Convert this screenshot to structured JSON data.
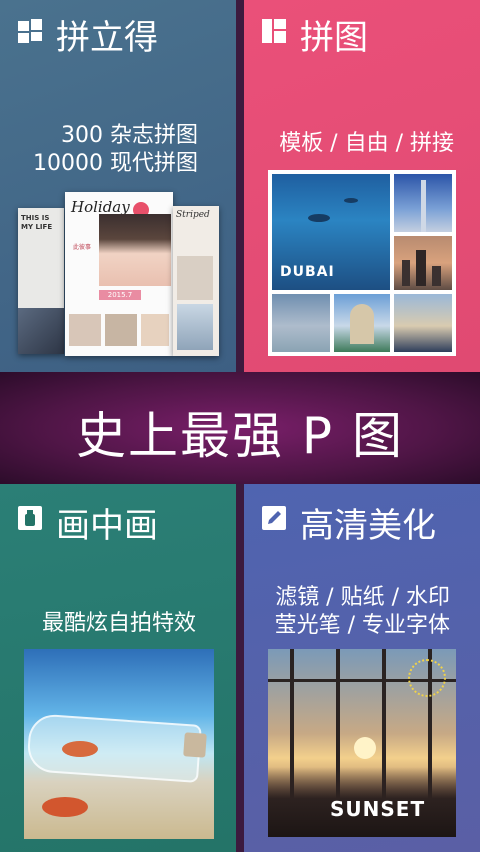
{
  "tiles": {
    "collage": {
      "title": "拼立得",
      "subtitle_line1": "300 杂志拼图",
      "subtitle_line2": "10000 现代拼图",
      "mag_left_text": "THIS IS MY LIFE",
      "mag_center_title": "Holiday",
      "mag_center_small": "此彼事",
      "mag_center_label": "2015.7",
      "mag_right_title": "Striped"
    },
    "puzzle": {
      "title": "拼图",
      "subtitle": "模板 / 自由 / 拼接",
      "photo_caption": "DUBAI"
    },
    "pip": {
      "title": "画中画",
      "subtitle": "最酷炫自拍特效"
    },
    "enhance": {
      "title": "高清美化",
      "subtitle_line1": "滤镜 / 贴纸 / 水印",
      "subtitle_line2": "莹光笔 / 专业字体",
      "photo_caption": "SUNSET"
    }
  },
  "banner": {
    "text": "史上最强 P 图"
  },
  "colors": {
    "collage_bg": "#4a728e",
    "puzzle_bg": "#ea5079",
    "pip_bg": "#2b7f76",
    "enhance_bg": "#4f64b0",
    "banner_bg": "#7a1f6a"
  },
  "icons": {
    "collage": "grid-icon",
    "puzzle": "layout-icon",
    "pip": "bottle-icon",
    "enhance": "pencil-icon"
  }
}
